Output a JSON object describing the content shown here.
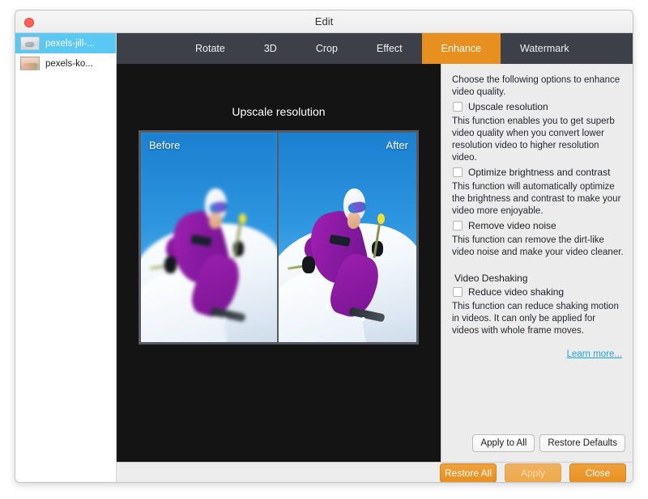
{
  "window": {
    "title": "Edit",
    "close_icon": "close-window-dot"
  },
  "sidebar": {
    "files": [
      {
        "name": "pexels-jill-...",
        "selected": true,
        "thumb": "snow-thumbnail"
      },
      {
        "name": "pexels-ko...",
        "selected": false,
        "thumb": "portrait-thumbnail"
      }
    ]
  },
  "tabs": [
    {
      "label": "Rotate",
      "active": false
    },
    {
      "label": "3D",
      "active": false
    },
    {
      "label": "Crop",
      "active": false
    },
    {
      "label": "Effect",
      "active": false
    },
    {
      "label": "Enhance",
      "active": true
    },
    {
      "label": "Watermark",
      "active": false
    }
  ],
  "preview": {
    "title": "Upscale resolution",
    "before_label": "Before",
    "after_label": "After"
  },
  "options": {
    "intro": "Choose the following options to enhance video quality.",
    "items": [
      {
        "label": "Upscale resolution",
        "checked": false,
        "description": "This function enables you to get superb video quality when you convert lower resolution video to higher resolution video."
      },
      {
        "label": "Optimize brightness and contrast",
        "checked": false,
        "description": "This function will automatically optimize the brightness and contrast to make your video more enjoyable."
      },
      {
        "label": "Remove video noise",
        "checked": false,
        "description": "This function can remove the dirt-like video noise and make your video cleaner."
      }
    ],
    "group": {
      "title": "Video Deshaking",
      "item": {
        "label": "Reduce video shaking",
        "checked": false,
        "description": "This function can reduce shaking motion in videos. It can only be applied for videos with whole frame moves."
      }
    },
    "learn_more": "Learn more...",
    "apply_to_all": "Apply to All",
    "restore_defaults": "Restore Defaults"
  },
  "footer": {
    "restore_all": "Restore All",
    "apply": "Apply",
    "apply_enabled": false,
    "close": "Close"
  },
  "colors": {
    "accent_orange": "#e8901f",
    "selection_blue": "#5ac8f2",
    "link_blue": "#1aa3e8",
    "tabbar_dark": "#3d4049",
    "stage_black": "#141414",
    "panel_gray": "#ececec"
  }
}
